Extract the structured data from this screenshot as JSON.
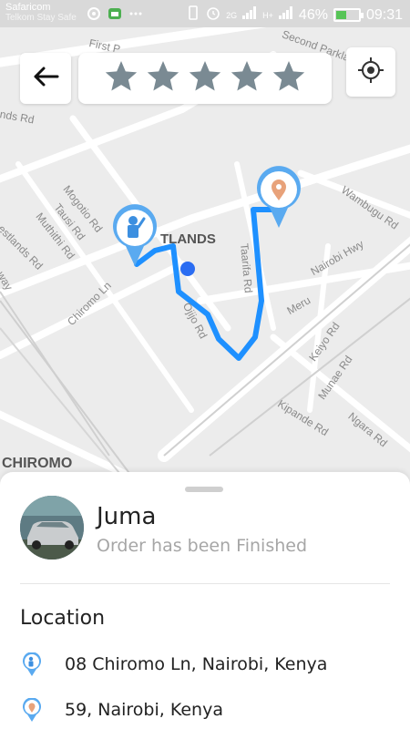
{
  "status_bar": {
    "carrier": "Safaricom",
    "carrier_sub": "Telkom Stay Safe",
    "network": "2G",
    "signal": "H+",
    "battery": "46%",
    "battery_level": 0.46,
    "time": "09:31"
  },
  "map": {
    "area_label": "TLANDS",
    "area_label2": "CHIROMO",
    "streets": {
      "first_pa": "First P",
      "second_parklands": "Second Parklands Ave",
      "lands_rd": "nds Rd",
      "mogotio": "Mogotio Rd",
      "tausi": "Tausi Rd",
      "muthithi": "Muthithi Rd",
      "westlands": "estlands Rd",
      "chiromo_ln": "Chiromo Ln",
      "ojijo": "Ojijo Rd",
      "taarifa": "Taarifa Rd",
      "meru": "Meru",
      "nairobi_hwy": "Nairobi Hwy",
      "wambugu": "Wambugu Rd",
      "keiyo": "Keiyo Rd",
      "munae": "Munae Rd",
      "ngara": "Ngara Rd",
      "kipande": "Kipande Rd",
      "way": "way"
    },
    "colors": {
      "route": "#1e90ff",
      "pickup_ring": "#5aaaf0",
      "dropoff_pin": "#e8a27a",
      "road": "#ffffff"
    }
  },
  "controls": {
    "back_icon": "arrow-left-icon",
    "rating": 5,
    "rating_max": 5,
    "locate_icon": "crosshair-icon",
    "star_color": "#7a8a93"
  },
  "driver": {
    "name": "Juma",
    "status": "Order has been Finished"
  },
  "location": {
    "title": "Location",
    "pickup": "08 Chiromo Ln, Nairobi, Kenya",
    "dropoff": "59, Nairobi, Kenya"
  }
}
